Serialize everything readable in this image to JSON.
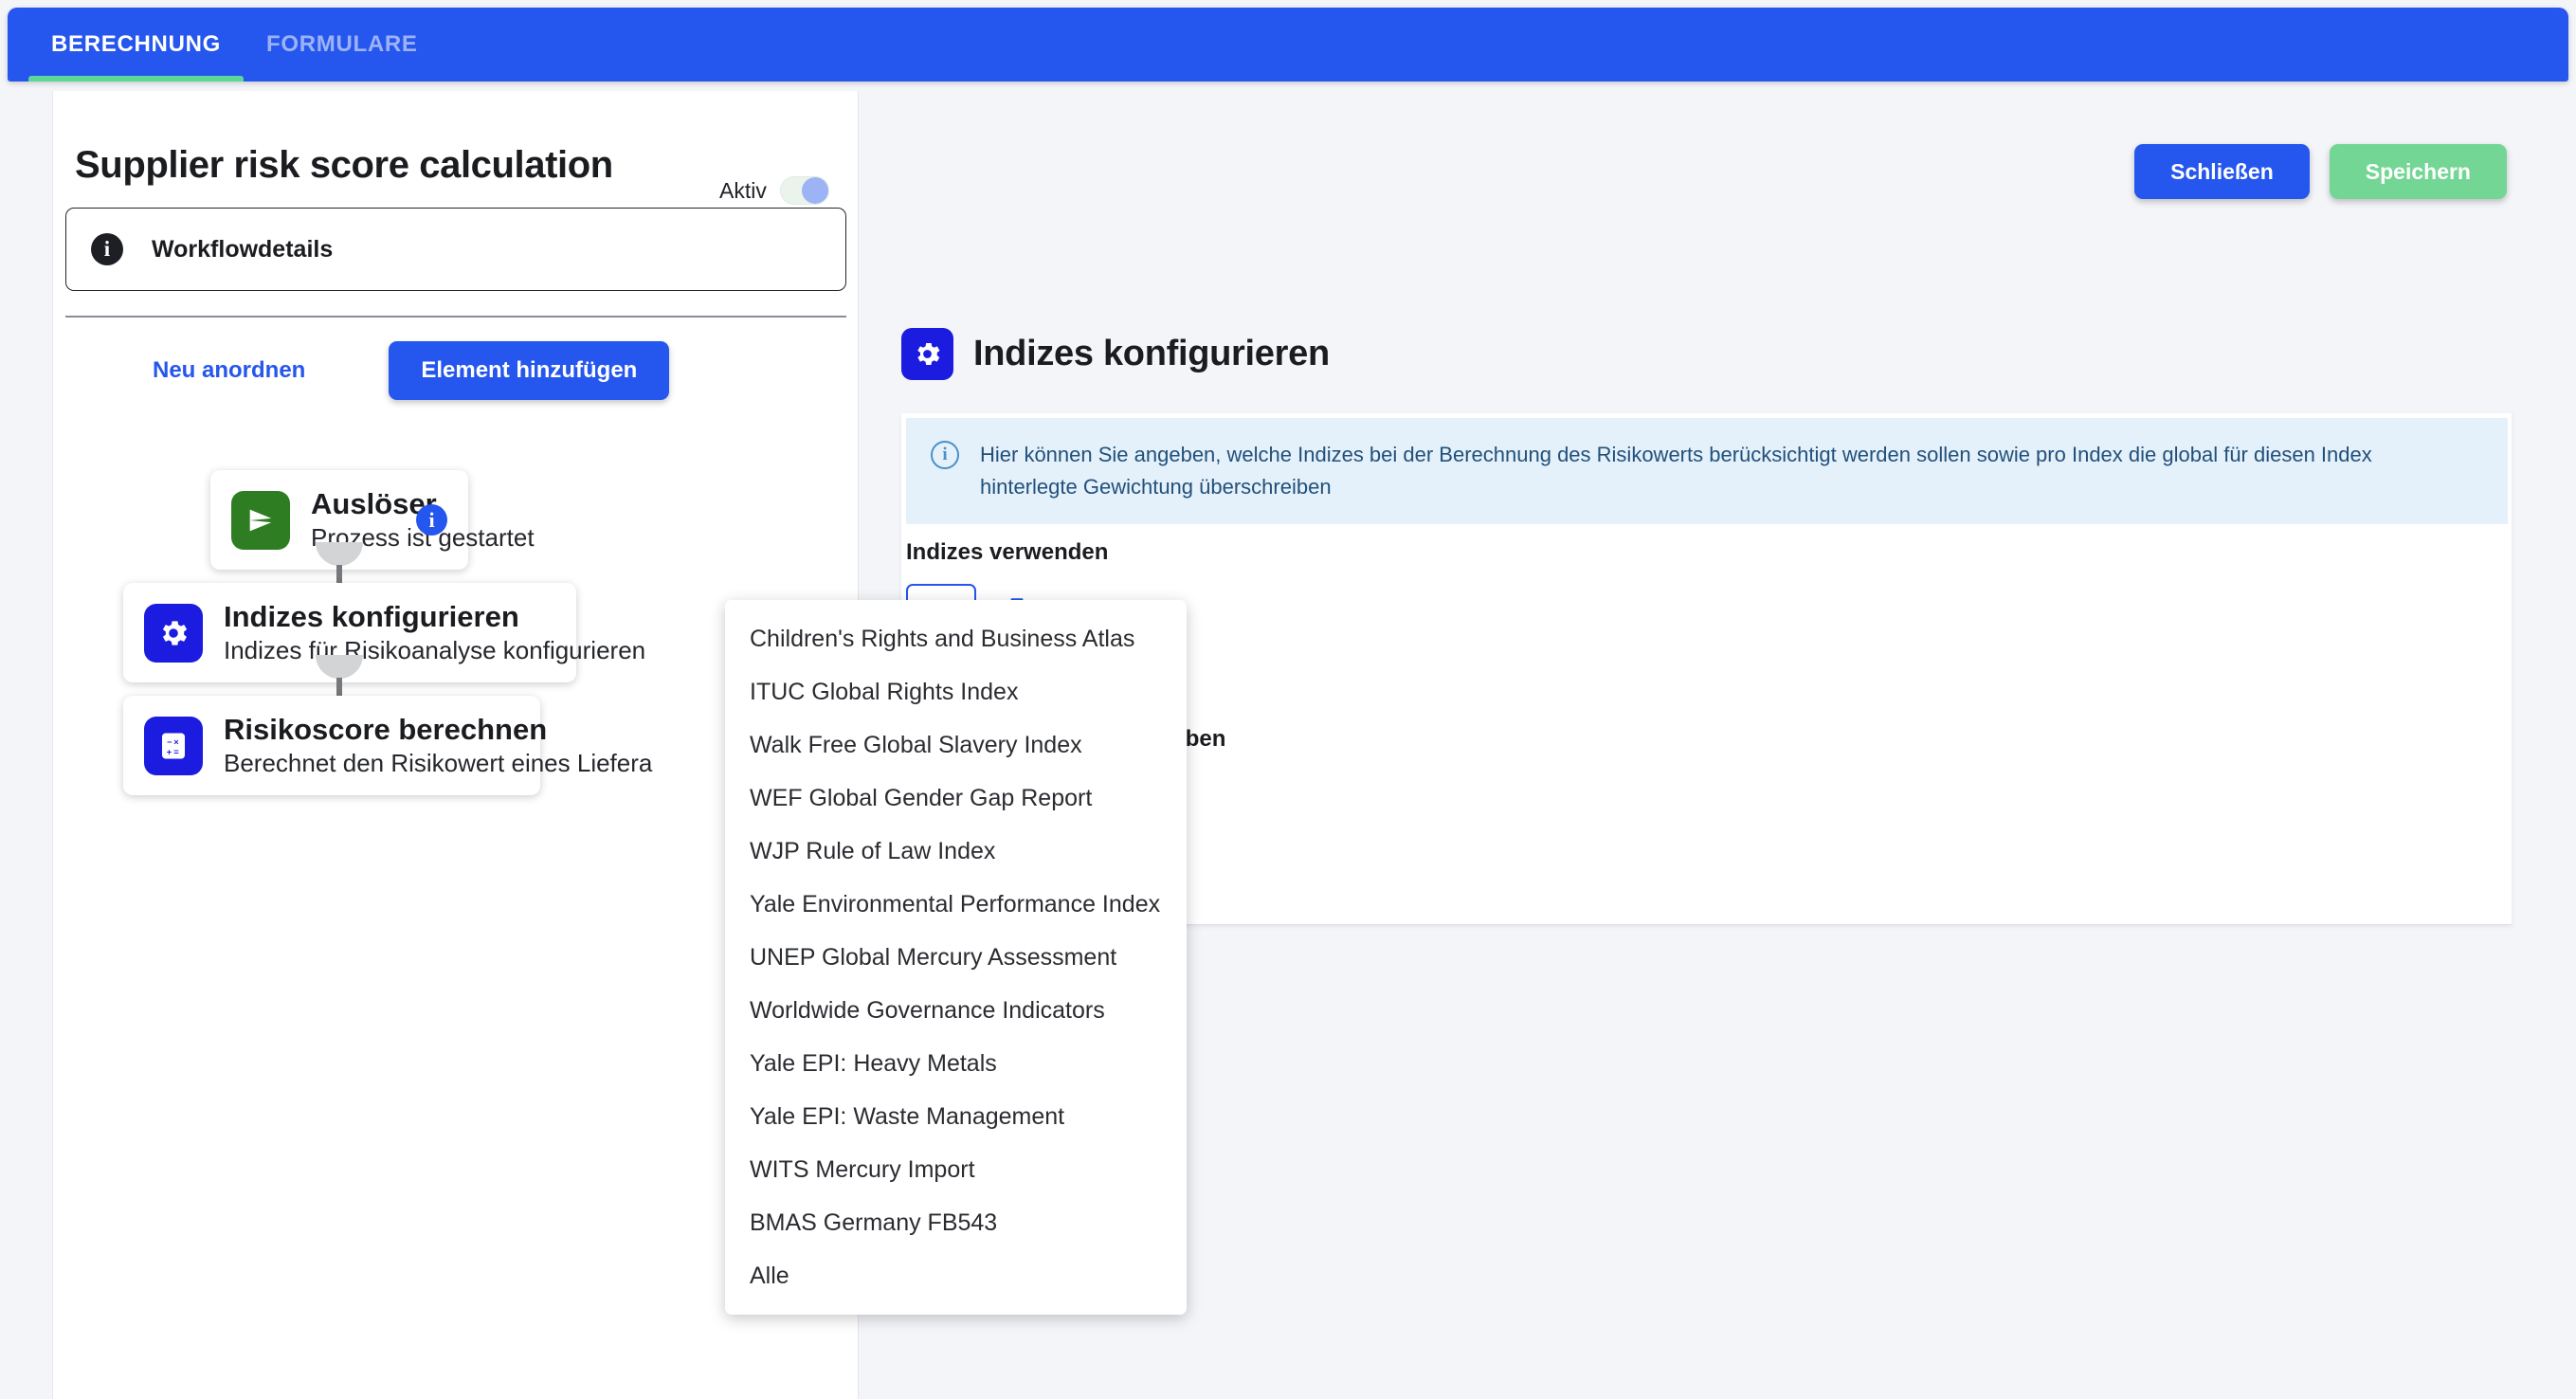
{
  "tabs": [
    {
      "label": "BERECHNUNG",
      "active": true
    },
    {
      "label": "FORMULARE",
      "active": false
    }
  ],
  "workflow": {
    "title": "Supplier risk score calculation",
    "active_label": "Aktiv",
    "active_state": "on",
    "details_label": "Workflowdetails",
    "details_icon": "info-icon",
    "reorder_label": "Neu anordnen",
    "add_element_label": "Element hinzufügen",
    "nodes": [
      {
        "title": "Auslöser",
        "description": "Prozess ist gestartet",
        "icon": "play-triangle-icon",
        "icon_color": "#2e7d22",
        "badge": "i"
      },
      {
        "title": "Indizes konfigurieren",
        "description": "Indizes für Risikoanalyse konfigurieren",
        "icon": "gear-icon",
        "icon_color": "#1c1ce0"
      },
      {
        "title": "Risikoscore berechnen",
        "description": "Berechnet den Risikowert eines Liefera",
        "icon": "calculator-icon",
        "icon_color": "#1c1ce0"
      }
    ]
  },
  "detail": {
    "close_label": "Schließen",
    "save_label": "Speichern",
    "heading": "Indizes konfigurieren",
    "heading_icon": "gear-icon",
    "banner_icon": "info-circle-icon",
    "banner_text": "Hier können Sie angeben, welche Indizes bei der Berechnung des Risikowerts berücksichtigt werden sollen sowie pro Index die global für diesen Index hinterlegte Gewichtung überschreiben",
    "field_label": "Indizes verwenden",
    "select_caret": "caret-up-icon",
    "delete_icon": "trash-icon",
    "obscured_heading": "Gewichtungen überschreiben"
  },
  "dropdown": {
    "open": true,
    "items": [
      "Children's Rights and Business Atlas",
      "ITUC Global Rights Index",
      "Walk Free Global Slavery Index",
      "WEF Global Gender Gap Report",
      "WJP Rule of Law Index",
      "Yale Environmental Performance Index",
      "UNEP Global Mercury Assessment",
      "Worldwide Governance Indicators",
      "Yale EPI: Heavy Metals",
      "Yale EPI: Waste Management",
      "WITS Mercury Import",
      "BMAS Germany FB543",
      "Alle"
    ]
  },
  "colors": {
    "primary_blue": "#2556ed",
    "accent_green": "#5cd896",
    "save_green": "#74d694",
    "icon_blue": "#1c1ce0",
    "trigger_green": "#2e7d22",
    "banner_bg": "#e4f1fb",
    "page_bg": "#f4f5f9"
  }
}
